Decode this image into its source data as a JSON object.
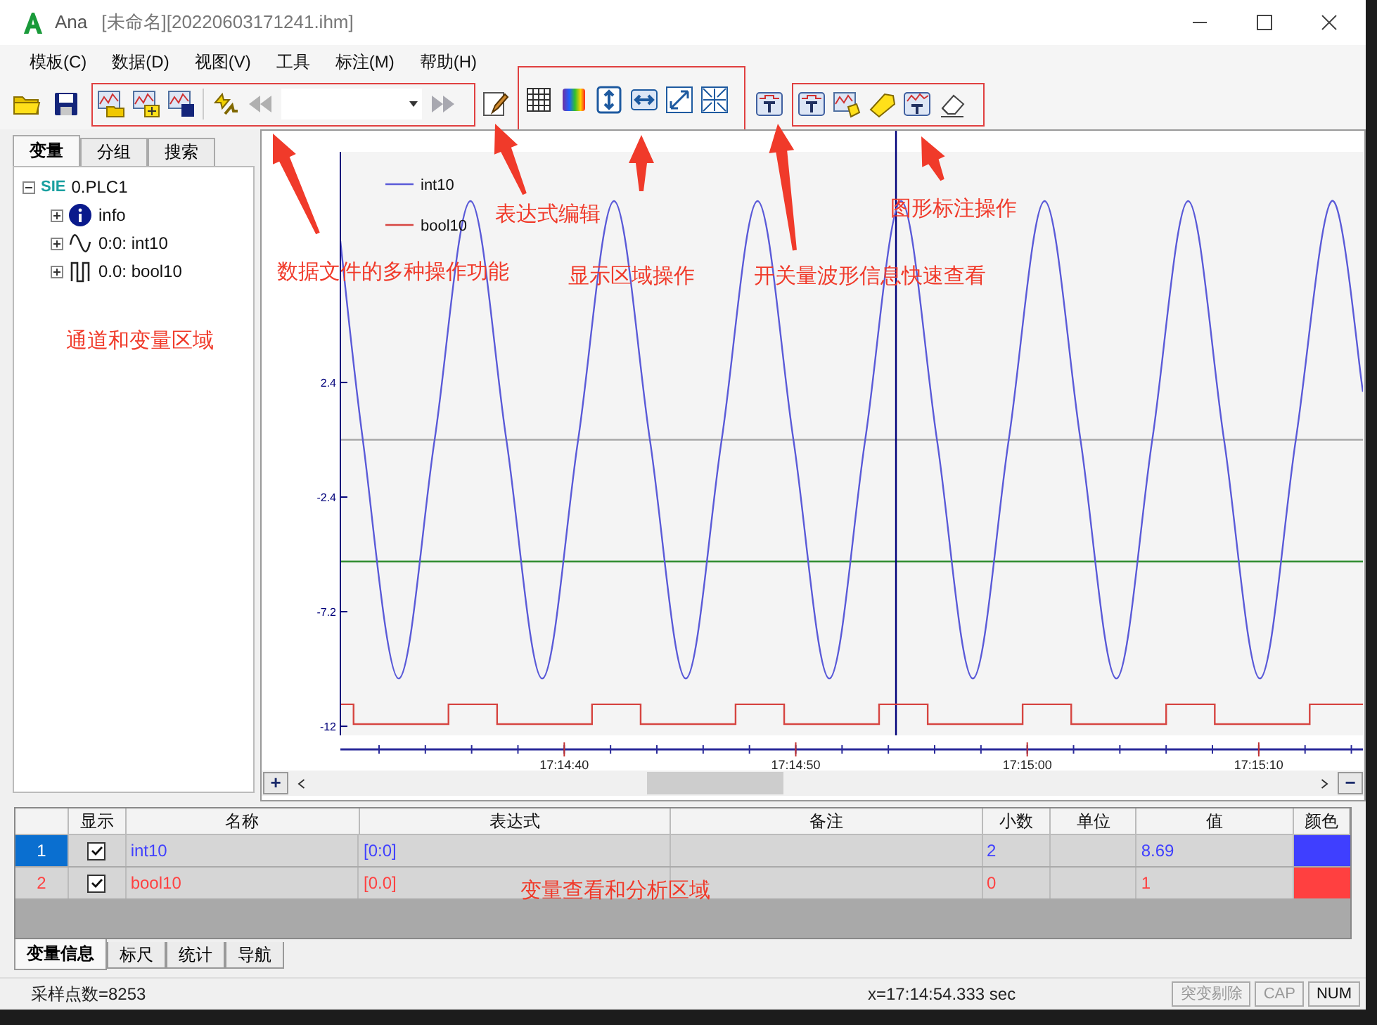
{
  "window": {
    "title": "Ana",
    "file": "[未命名][20220603171241.ihm]"
  },
  "menu": [
    "模板(C)",
    "数据(D)",
    "视图(V)",
    "工具",
    "标注(M)",
    "帮助(H)"
  ],
  "left_panel": {
    "tabs": [
      {
        "label": "变量",
        "selected": true
      },
      {
        "label": "分组",
        "selected": false
      },
      {
        "label": "搜索",
        "selected": false
      }
    ],
    "tree": [
      {
        "badge": "SIE",
        "label": "0.PLC1",
        "kind": "device",
        "expanded": true,
        "children": [
          {
            "label": "info",
            "kind": "info",
            "expanded": false
          },
          {
            "label": "0:0: int10",
            "kind": "analog",
            "expanded": false
          },
          {
            "label": "0.0: bool10",
            "kind": "digital",
            "expanded": false
          }
        ]
      }
    ]
  },
  "chart": {
    "zoom_in": "+",
    "zoom_out": "−",
    "chart_data": {
      "type": "line",
      "legend": "upper left",
      "xlim": [
        62070.33,
        62114.5
      ],
      "ylim": [
        -12.38,
        12.06
      ],
      "yticks": [
        2.4,
        -2.4,
        -7.2,
        -12
      ],
      "xticks": [
        {
          "value": 62080,
          "label": "17:14:40"
        },
        {
          "value": 62090,
          "label": "17:14:50"
        },
        {
          "value": 62100,
          "label": "17:15:00"
        },
        {
          "value": 62110,
          "label": "17:15:10"
        }
      ],
      "x": [
        62070.33,
        62071.3,
        62072.85,
        62074.4,
        62075.95,
        62077.5,
        62079.05,
        62080.6,
        62082.15,
        62083.7,
        62085.25,
        62086.8,
        62088.35,
        62089.9,
        62091.45,
        62093,
        62094.55,
        62096.1,
        62097.65,
        62099.2,
        62100.75,
        62102.3,
        62103.85,
        62105.4,
        62106.95,
        62108.5,
        62110.05,
        62111.6,
        62113.15,
        62114.5
      ],
      "series": [
        {
          "name": "int10",
          "color": "#5a5ad8",
          "values": [
            8.32,
            0,
            -10,
            0,
            10,
            0,
            -10,
            0,
            10,
            0,
            -10,
            0,
            10,
            0,
            -10,
            0,
            10,
            0,
            -10,
            0,
            10,
            0,
            -10,
            0,
            10,
            0,
            -10,
            0,
            10,
            2.01
          ]
        },
        {
          "name": "bool10",
          "color": "#d64541",
          "x": [
            62070.33,
            62070.9,
            62070.9,
            62075,
            62075,
            62077.1,
            62077.1,
            62081.2,
            62081.2,
            62083.3,
            62083.3,
            62087.4,
            62087.4,
            62089.5,
            62089.5,
            62093.6,
            62093.6,
            62095.7,
            62095.7,
            62099.8,
            62099.8,
            62101.9,
            62101.9,
            62106,
            62106,
            62108.1,
            62108.1,
            62112.2,
            62112.2,
            62114.5
          ],
          "values": [
            -11.08,
            -11.08,
            -11.91,
            -11.91,
            -11.08,
            -11.08,
            -11.91,
            -11.91,
            -11.08,
            -11.08,
            -11.91,
            -11.91,
            -11.08,
            -11.08,
            -11.91,
            -11.91,
            -11.08,
            -11.08,
            -11.91,
            -11.91,
            -11.08,
            -11.08,
            -11.91,
            -11.91,
            -11.08,
            -11.08,
            -11.91,
            -11.91,
            -11.08,
            -11.08
          ]
        }
      ],
      "ref_lines": [
        {
          "axis": "y",
          "value": 0
        },
        {
          "axis": "y",
          "value": -5.1
        },
        {
          "axis": "x",
          "value": 62094.33
        }
      ]
    }
  },
  "table": {
    "columns": [
      "显示",
      "名称",
      "表达式",
      "备注",
      "小数",
      "单位",
      "值",
      "颜色"
    ],
    "rows": [
      {
        "index": "1",
        "selected": true,
        "visible": true,
        "name": "int10",
        "expression": "[0:0]",
        "decimals": "2",
        "value": "8.69",
        "color": "#3f3fff"
      },
      {
        "index": "2",
        "selected": false,
        "visible": true,
        "name": "bool10",
        "expression": "[0.0]",
        "decimals": "0",
        "value": "1",
        "color": "#ff4040"
      }
    ]
  },
  "bottom_tabs": [
    {
      "label": "变量信息",
      "selected": true
    },
    {
      "label": "标尺",
      "selected": false
    },
    {
      "label": "统计",
      "selected": false
    },
    {
      "label": "导航",
      "selected": false
    }
  ],
  "status_bar": {
    "sample_count": "采样点数=8253",
    "cursor": "x=17:14:54.333 sec",
    "indicators": [
      {
        "label": "突变剔除",
        "active": false
      },
      {
        "label": "CAP",
        "active": false
      },
      {
        "label": "NUM",
        "active": true
      }
    ]
  },
  "annotations": [
    "图形标注操作",
    "表达式编辑",
    "数据文件的多种操作功能",
    "显示区域操作",
    "开关量波形信息快速查看",
    "通道和变量区域",
    "变量查看和分析区域"
  ]
}
